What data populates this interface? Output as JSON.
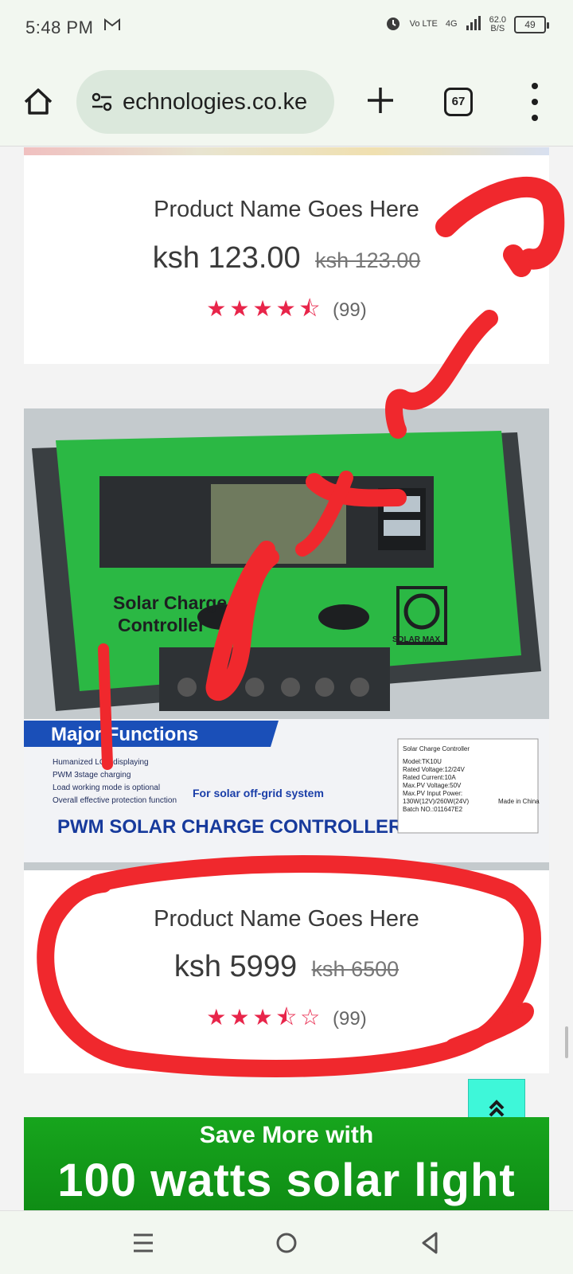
{
  "status_bar": {
    "time": "5:48 PM",
    "network": "Vo LTE",
    "network_type": "4G",
    "speed_value": "62.0",
    "speed_unit": "B/S",
    "battery": "49",
    "icons": [
      "gmail-icon",
      "alarm-icon",
      "signal-icon",
      "battery-icon"
    ]
  },
  "browser": {
    "url": "echnologies.co.ke",
    "tab_count": "67",
    "icons": [
      "home-icon",
      "site-info-icon",
      "new-tab-icon",
      "tab-switcher-icon",
      "menu-icon"
    ]
  },
  "products": [
    {
      "name": "Product Name Goes Here",
      "price": "ksh 123.00",
      "old_price": "ksh 123.00",
      "rating": 4.5,
      "rating_max": 5,
      "reviews": "(99)"
    },
    {
      "name": "Product Name Goes Here",
      "price": "ksh 5999",
      "old_price": "ksh 6500",
      "rating": 3.5,
      "rating_max": 5,
      "reviews": "(99)",
      "image": {
        "label_line1": "Solar Charge",
        "label_line2": "Controller",
        "brand": "SOLAR MAX",
        "box_heading": "Major Functions",
        "box_features": [
          "Humanized LCD displaying",
          "PWM 3stage charging",
          "Load working mode is optional",
          "Overall effective protection function"
        ],
        "box_tagline": "For solar off-grid system",
        "box_title": "PWM SOLAR CHARGE CONTROLLER",
        "spec_title": "Solar Charge Controller",
        "spec_lines": [
          "Model:TK10U",
          "Rated Voltage:12/24V",
          "Rated Current:10A",
          "Max.PV Voltage:50V",
          "Max.PV Input Power:",
          "130W(12V)/260W(24V)",
          "Batch NO.:011647E2"
        ],
        "made_in": "Made in China"
      }
    }
  ],
  "banner": {
    "line1": "Save More with",
    "line2": "100 watts solar light"
  },
  "colors": {
    "accent_star": "#e8254a",
    "back_to_top": "#3ef7d9",
    "banner_green": "#17a51d",
    "scribble_red": "#f0282d"
  }
}
